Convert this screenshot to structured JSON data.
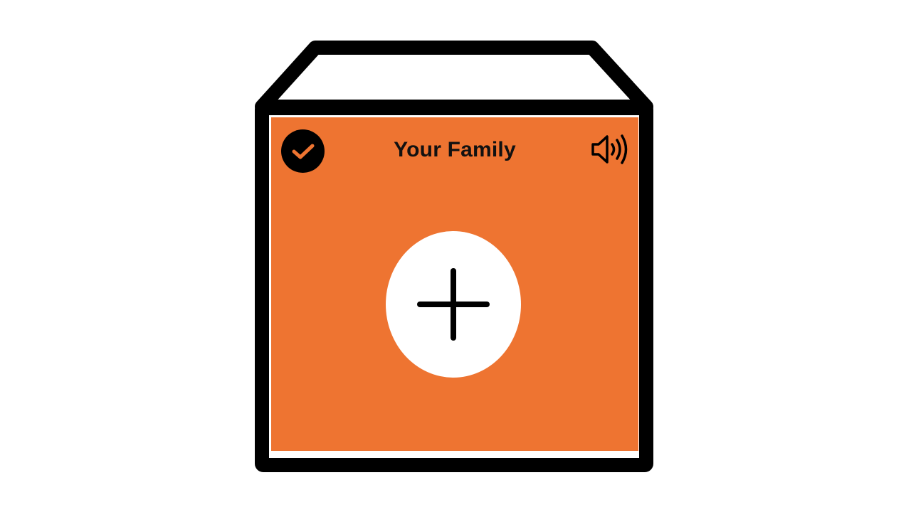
{
  "card": {
    "title": "Your Family",
    "accent_color": "#ee7431",
    "frame_color": "#000000"
  },
  "icons": {
    "confirm": "check-circle-icon",
    "audio": "speaker-volume-icon",
    "add": "plus-icon"
  }
}
